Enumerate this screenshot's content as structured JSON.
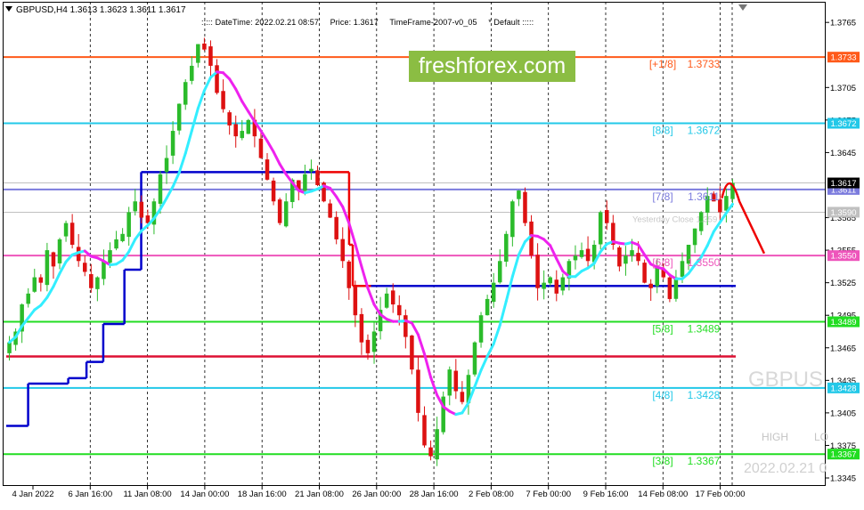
{
  "header": {
    "symbol_line": "GBPUSD,H4  1.3613 1.3623 1.3611 1.3617"
  },
  "infobar": {
    "datetime": "::::: DateTime: 2022.02.21 08:57",
    "price": "Price: 1.3617",
    "timeframe": "TimeFrame-2007-v0_05",
    "default": "*  Default  :::::"
  },
  "logo_text": "freshforex.com",
  "ghost": {
    "symbol": "GBPUS",
    "high": "HIGH",
    "low": "LO",
    "date": "2022.02.21 0"
  },
  "colors": {
    "bull": "#2bbb2b",
    "bear": "#dd1111",
    "orange": "#ff5a1a",
    "cyan": "#22c8e8",
    "slate": "#7b7bdd",
    "silver": "#c0c0c0",
    "pink": "#ee55bb",
    "green": "#22dd22",
    "crimson": "#dd1133",
    "blue": "#0000cc",
    "aqua": "#33eeff",
    "magenta": "#ee22ee",
    "red": "#ee0000"
  },
  "chart_data": {
    "type": "candlestick",
    "symbol": "GBPUSD",
    "timeframe": "H4",
    "ylim": [
      1.3345,
      1.3775
    ],
    "y_ticks": [
      "1.3765",
      "1.3705",
      "1.3675",
      "1.3645",
      "1.3585",
      "1.3555",
      "1.3525",
      "1.3495",
      "1.3465",
      "1.3435",
      "1.3405",
      "1.3375",
      "1.3345"
    ],
    "x_ticks": [
      "4 Jan 2022",
      "6 Jan 16:00",
      "11 Jan 08:00",
      "14 Jan 00:00",
      "18 Jan 16:00",
      "21 Jan 08:00",
      "26 Jan 00:00",
      "28 Jan 16:00",
      "2 Feb 08:00",
      "7 Feb 00:00",
      "9 Feb 16:00",
      "14 Feb 08:00",
      "17 Feb 00:00"
    ],
    "murrey_levels": [
      {
        "label": "[+1/8]",
        "value": 1.3733,
        "value_text": "1.3733",
        "color": "orange",
        "y_tag": "1.3733",
        "shown": true
      },
      {
        "label": "[8/8]",
        "value": 1.3672,
        "value_text": "1.3672",
        "color": "cyan",
        "y_tag": "1.3672",
        "shown": true
      },
      {
        "label": "[7/8]",
        "value": 1.3611,
        "value_text": "1.3611",
        "color": "slate",
        "y_tag": "1.3611",
        "shown": true
      },
      {
        "label": "[6/8]",
        "value": 1.355,
        "value_text": "1.3550",
        "color": "pink",
        "y_tag": "1.3550",
        "shown": true
      },
      {
        "label": "[5/8]",
        "value": 1.3489,
        "value_text": "1.3489",
        "color": "green",
        "y_tag": "1.3489",
        "shown": true
      },
      {
        "label": "[4/8]",
        "value": 1.3428,
        "value_text": "1.3428",
        "color": "cyan",
        "y_tag": "1.3428",
        "shown": true
      },
      {
        "label": "[3/8]",
        "value": 1.3367,
        "value_text": "1.3367",
        "color": "green",
        "y_tag": "1.3367",
        "shown": true
      }
    ],
    "price_tags": [
      {
        "value": 1.3617,
        "text": "1.3617",
        "bg": "#000000",
        "fg": "#ffffff"
      },
      {
        "value": 1.359,
        "text": "1.3590",
        "bg": "#c0c0c0",
        "fg": "#ffffff"
      }
    ],
    "reference_lines": [
      {
        "value": 1.3617,
        "color": "silver"
      },
      {
        "value": 1.359,
        "color": "silver"
      }
    ],
    "yesterday_close_label": "Yesterday Close 1.359",
    "extra_lines": [
      {
        "value": 1.3522,
        "color": "blue",
        "from_x_frac": 0.495
      },
      {
        "value": 1.3457,
        "color": "crimson",
        "from_x_frac": 0.0
      }
    ],
    "staircase": [
      {
        "value": 1.3393,
        "x0": 0.0,
        "x1": 0.03,
        "color": "blue"
      },
      {
        "value": 1.3432,
        "x0": 0.03,
        "x1": 0.085,
        "color": "blue"
      },
      {
        "value": 1.3437,
        "x0": 0.085,
        "x1": 0.11,
        "color": "blue"
      },
      {
        "value": 1.3452,
        "x0": 0.11,
        "x1": 0.133,
        "color": "blue"
      },
      {
        "value": 1.3487,
        "x0": 0.133,
        "x1": 0.162,
        "color": "blue"
      },
      {
        "value": 1.3537,
        "x0": 0.162,
        "x1": 0.185,
        "color": "blue"
      },
      {
        "value": 1.3627,
        "x0": 0.185,
        "x1": 0.43,
        "color": "blue"
      },
      {
        "value": 1.3627,
        "x0": 0.43,
        "x1": 0.47,
        "color": "red"
      },
      {
        "value": 1.356,
        "x0": 0.47,
        "x1": 0.475,
        "color": "red"
      },
      {
        "value": 1.3522,
        "x0": 0.475,
        "x1": 0.5,
        "color": "red"
      }
    ],
    "forecast": [
      {
        "x": 0.981,
        "value": 1.3603
      },
      {
        "x": 0.991,
        "value": 1.3625
      },
      {
        "x": 1.005,
        "value": 1.36
      },
      {
        "x": 1.039,
        "value": 1.3552
      }
    ],
    "price_series": [
      1.347,
      1.348,
      1.3505,
      1.3515,
      1.353,
      1.3525,
      1.3555,
      1.354,
      1.3565,
      1.358,
      1.356,
      1.3545,
      1.3535,
      1.352,
      1.353,
      1.3545,
      1.3555,
      1.3565,
      1.357,
      1.359,
      1.36,
      1.3585,
      1.358,
      1.36,
      1.3625,
      1.364,
      1.3665,
      1.369,
      1.371,
      1.3725,
      1.3745,
      1.374,
      1.3725,
      1.37,
      1.3685,
      1.367,
      1.366,
      1.3665,
      1.3675,
      1.366,
      1.364,
      1.362,
      1.36,
      1.358,
      1.36,
      1.362,
      1.361,
      1.3625,
      1.363,
      1.3615,
      1.36,
      1.3585,
      1.3565,
      1.3545,
      1.352,
      1.3495,
      1.347,
      1.346,
      1.348,
      1.35,
      1.3515,
      1.3505,
      1.3495,
      1.3475,
      1.3445,
      1.3405,
      1.3375,
      1.3365,
      1.339,
      1.342,
      1.3445,
      1.3425,
      1.3415,
      1.344,
      1.347,
      1.3495,
      1.351,
      1.3525,
      1.3545,
      1.357,
      1.36,
      1.361,
      1.358,
      1.355,
      1.352,
      1.3525,
      1.353,
      1.3515,
      1.353,
      1.3545,
      1.355,
      1.3555,
      1.3545,
      1.356,
      1.359,
      1.358,
      1.356,
      1.354,
      1.355,
      1.3555,
      1.3545,
      1.3525,
      1.352,
      1.354,
      1.353,
      1.351,
      1.353,
      1.3545,
      1.356,
      1.3575,
      1.359,
      1.3605,
      1.36,
      1.359,
      1.3605,
      1.3617
    ]
  }
}
